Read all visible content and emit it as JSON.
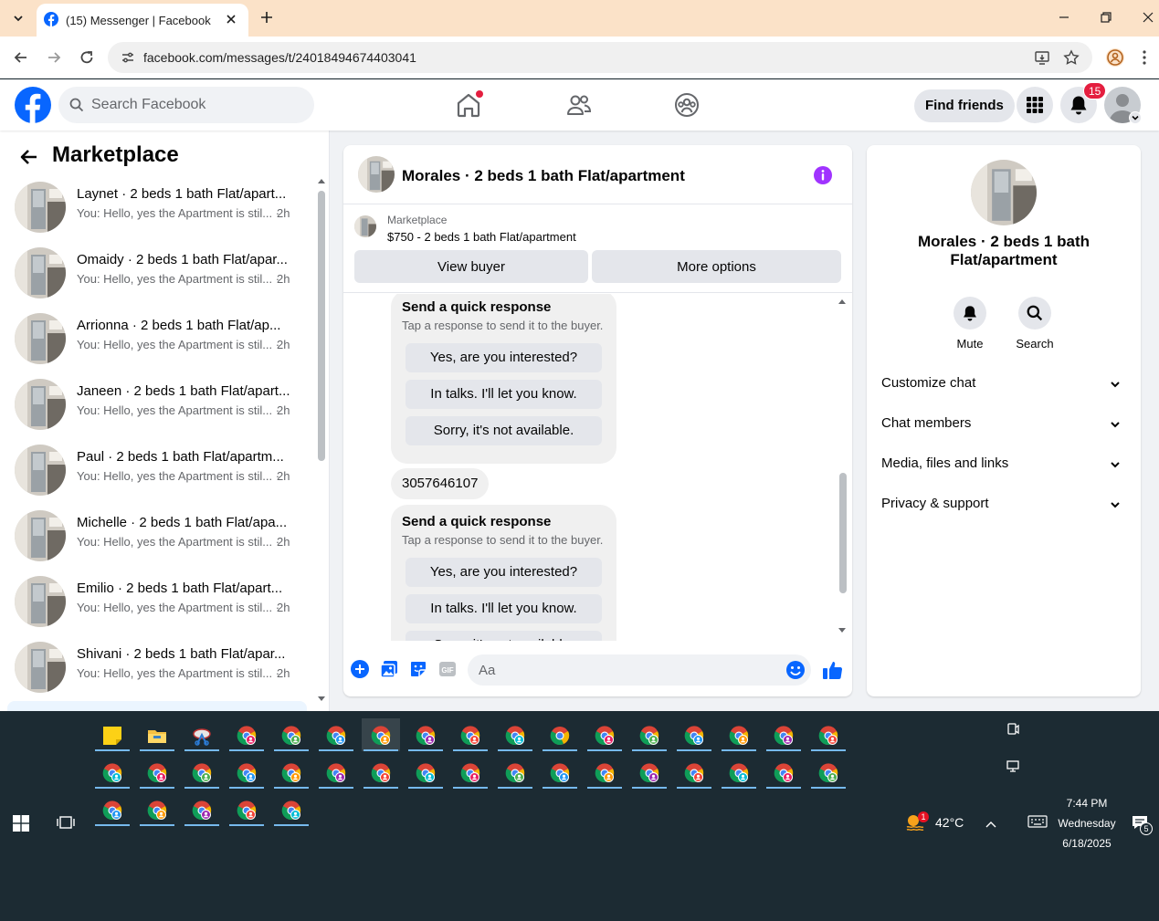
{
  "browser": {
    "tab_title": "(15) Messenger | Facebook",
    "url": "facebook.com/messages/t/24018494674403041"
  },
  "fb": {
    "search_placeholder": "Search Facebook",
    "find_friends": "Find friends",
    "notif_count": "15"
  },
  "sidebar": {
    "title": "Marketplace",
    "conversations": [
      {
        "name": "Laynet · 2 beds 1 bath Flat/apart...",
        "preview": "You: Hello, yes the Apartment is stil... ·",
        "time": "2h"
      },
      {
        "name": "Omaidy · 2 beds 1 bath Flat/apar...",
        "preview": "You: Hello, yes the Apartment is stil... ·",
        "time": "2h"
      },
      {
        "name": "Arrionna · 2 beds 1 bath Flat/ap...",
        "preview": "You: Hello, yes the Apartment is stil... ·",
        "time": "2h"
      },
      {
        "name": "Janeen · 2 beds 1 bath Flat/apart...",
        "preview": "You: Hello, yes the Apartment is stil... ·",
        "time": "2h"
      },
      {
        "name": "Paul · 2 beds 1 bath Flat/apartm...",
        "preview": "You: Hello, yes the Apartment is stil... ·",
        "time": "2h"
      },
      {
        "name": "Michelle · 2 beds 1 bath Flat/apa...",
        "preview": "You: Hello, yes the Apartment is stil... ·",
        "time": "2h"
      },
      {
        "name": "Emilio · 2 beds 1 bath Flat/apart...",
        "preview": "You: Hello, yes the Apartment is stil... ·",
        "time": "2h"
      },
      {
        "name": "Shivani · 2 beds 1 bath Flat/apar...",
        "preview": "You: Hello, yes the Apartment is stil... ·",
        "time": "2h"
      }
    ]
  },
  "chat": {
    "title": "Morales · 2 beds 1 bath Flat/apartment",
    "listing_label": "Marketplace",
    "listing_price": "$750 - 2 beds 1 bath Flat/apartment",
    "view_buyer": "View buyer",
    "more_options": "More options",
    "quick_title": "Send a quick response",
    "quick_sub": "Tap a response to send it to the buyer.",
    "opt1": "Yes, are you interested?",
    "opt2": "In talks. I'll let you know.",
    "opt3": "Sorry, it's not available.",
    "phone": "3057646107",
    "input_placeholder": "Aa"
  },
  "info": {
    "title": "Morales · 2 beds 1 bath Flat/apartment",
    "mute": "Mute",
    "search": "Search",
    "sections": [
      "Customize chat",
      "Chat members",
      "Media, files and links",
      "Privacy & support"
    ]
  },
  "taskbar": {
    "temperature": "42°C",
    "weather_badge": "1",
    "time": "7:44 PM",
    "day": "Wednesday",
    "date": "6/18/2025",
    "notif_count": "5"
  },
  "colors": {
    "fb_blue": "#0866ff",
    "messenger_purple": "#a033ff",
    "badge_red": "#e41e3f"
  }
}
